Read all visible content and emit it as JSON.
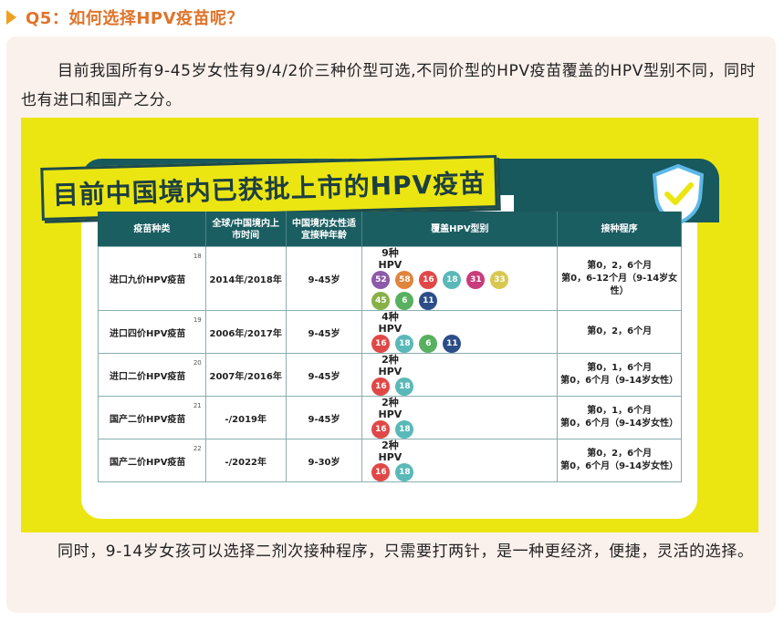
{
  "question": {
    "title": "Q5：如何选择HPV疫苗呢？"
  },
  "paragraphs": {
    "intro": "目前我国所有9-45岁女性有9/4/2价三种价型可选,不同价型的HPV疫苗覆盖的HPV型别不同，同时也有进口和国产之分。",
    "outro": "同时，9-14岁女孩可以选择二剂次接种程序，只需要打两针，是一种更经济，便捷，灵活的选择。"
  },
  "figure": {
    "banner": "目前中国境内已获批上市的HPV疫苗",
    "headers": [
      "疫苗种类",
      "全球/中国境内上市时间",
      "中国境内女性适宜接种年龄",
      "覆盖HPV型别",
      "接种程序"
    ],
    "rows": [
      {
        "name": "进口九价HPV疫苗",
        "ref": "18",
        "date": "2014年/2018年",
        "age": "9-45岁",
        "count": "9种HPV",
        "types": [
          "52",
          "58",
          "16",
          "18",
          "31",
          "33",
          "45",
          "6",
          "11"
        ],
        "schedule": "第0，2，6个月\n第0，6-12个月（9-14岁女性）"
      },
      {
        "name": "进口四价HPV疫苗",
        "ref": "19",
        "date": "2006年/2017年",
        "age": "9-45岁",
        "count": "4种HPV",
        "types": [
          "16",
          "18",
          "6",
          "11"
        ],
        "schedule": "第0，2，6个月"
      },
      {
        "name": "进口二价HPV疫苗",
        "ref": "20",
        "date": "2007年/2016年",
        "age": "9-45岁",
        "count": "2种HPV",
        "types": [
          "16",
          "18"
        ],
        "schedule": "第0，1，6个月\n第0，6个月（9-14岁女性）"
      },
      {
        "name": "国产二价HPV疫苗",
        "ref": "21",
        "date": "-/2019年",
        "age": "9-45岁",
        "count": "2种HPV",
        "types": [
          "16",
          "18"
        ],
        "schedule": "第0，1，6个月\n第0，6个月（9-14岁女性）"
      },
      {
        "name": "国产二价HPV疫苗",
        "ref": "22",
        "date": "-/2022年",
        "age": "9-30岁",
        "count": "2种HPV",
        "types": [
          "16",
          "18"
        ],
        "schedule": "第0，2，6个月\n第0，6个月（9-14岁女性）"
      }
    ]
  },
  "colors": {
    "accent": "#e0742a",
    "figure_bg": "#ebe611",
    "teal": "#1b5e62",
    "badge_16": "#e04848",
    "badge_18": "#5ab8b8",
    "badge_6": "#58b060",
    "badge_11": "#2c4e88",
    "badge_52": "#8c5aa8",
    "badge_58": "#e0843c",
    "badge_31": "#c83c7c",
    "badge_33": "#d8c850",
    "badge_45": "#88b048"
  },
  "icons": {
    "shield": "shield-check-icon",
    "arrow": "triangle-right-icon"
  }
}
